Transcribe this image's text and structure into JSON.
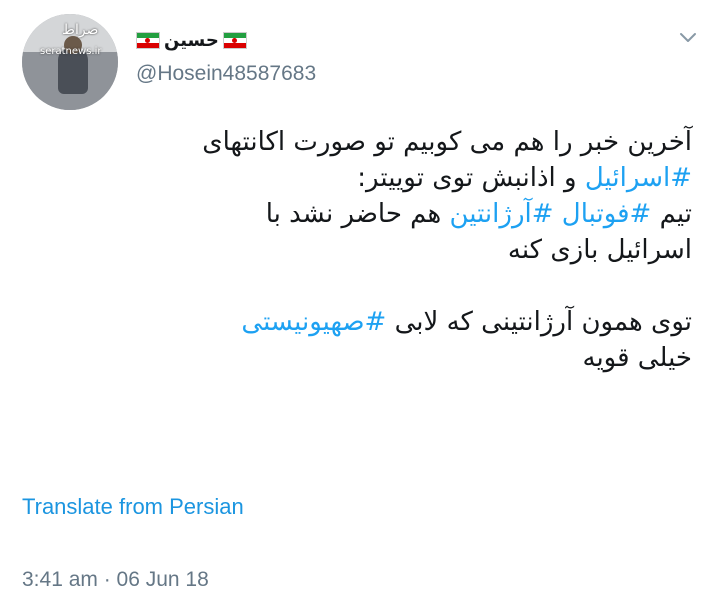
{
  "user": {
    "display_name": "حسین",
    "handle": "@Hosein48587683",
    "avatar_watermark": "seratnews.ir",
    "avatar_logo": "صراط"
  },
  "tweet": {
    "lines": [
      [
        {
          "t": "آخرین خبر را هم می کوبیم تو صورت اکانتهای",
          "h": false
        }
      ],
      [
        {
          "t": "#اسرائیل",
          "h": true
        },
        {
          "t": " و اذانبش توی توییتر:",
          "h": false
        }
      ],
      [
        {
          "t": "تیم ",
          "h": false
        },
        {
          "t": "#فوتبال",
          "h": true
        },
        {
          "t": " ",
          "h": false
        },
        {
          "t": "#آرژانتین",
          "h": true
        },
        {
          "t": " هم حاضر نشد با",
          "h": false
        }
      ],
      [
        {
          "t": "اسرائیل بازی کنه",
          "h": false
        }
      ],
      [],
      [
        {
          "t": "توی همون آرژانتینی که لابی ",
          "h": false
        },
        {
          "t": "#صهیونیستی",
          "h": true
        }
      ],
      [
        {
          "t": "خیلی قویه",
          "h": false
        }
      ]
    ]
  },
  "translate_label": "Translate from Persian",
  "timestamp": "3:41 am · 06 Jun 18",
  "colors": {
    "hashtag": "#1da1f2",
    "link": "#1b95e0",
    "muted": "#657786"
  }
}
